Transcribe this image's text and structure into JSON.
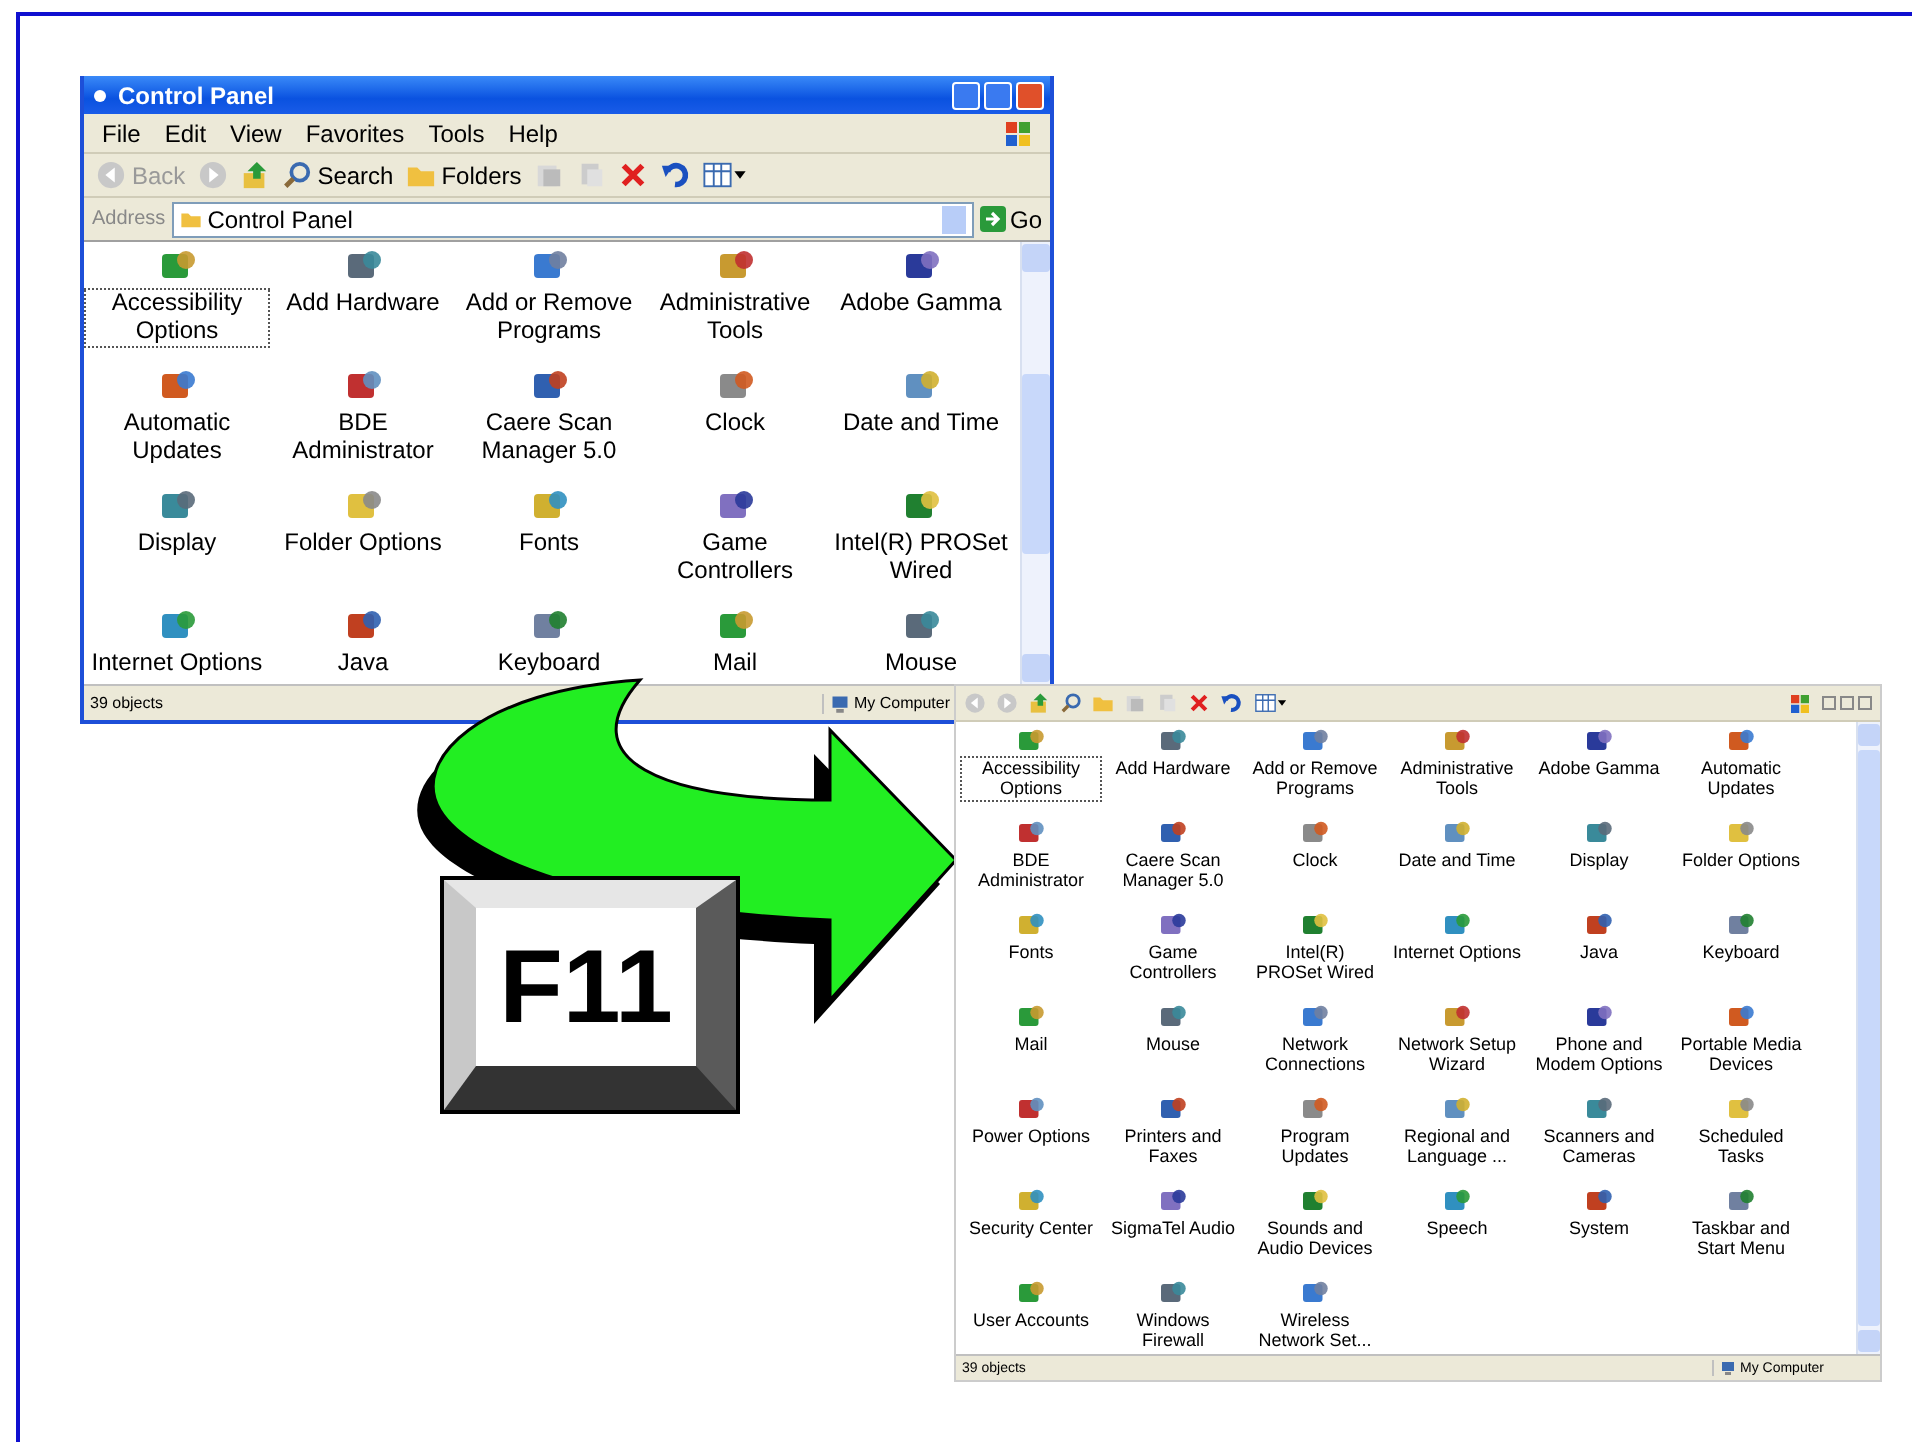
{
  "window": {
    "title": "Control Panel",
    "menu": [
      {
        "label": "File"
      },
      {
        "label": "Edit"
      },
      {
        "label": "View"
      },
      {
        "label": "Favorites"
      },
      {
        "label": "Tools"
      },
      {
        "label": "Help"
      }
    ],
    "toolbar": {
      "back": "Back",
      "search": "Search",
      "folders": "Folders"
    },
    "address": {
      "label": "Address",
      "value": "Control Panel",
      "go": "Go"
    },
    "items": [
      {
        "label": "Accessibility Options",
        "selected": true
      },
      {
        "label": "Add Hardware",
        "selected": false
      },
      {
        "label": "Add or Remove Programs",
        "selected": false
      },
      {
        "label": "Administrative Tools",
        "selected": false
      },
      {
        "label": "Adobe Gamma",
        "selected": false
      },
      {
        "label": "Automatic Updates",
        "selected": false
      },
      {
        "label": "BDE Administrator",
        "selected": false
      },
      {
        "label": "Caere Scan Manager 5.0",
        "selected": false
      },
      {
        "label": "Clock",
        "selected": false
      },
      {
        "label": "Date and Time",
        "selected": false
      },
      {
        "label": "Display",
        "selected": false
      },
      {
        "label": "Folder Options",
        "selected": false
      },
      {
        "label": "Fonts",
        "selected": false
      },
      {
        "label": "Game Controllers",
        "selected": false
      },
      {
        "label": "Intel(R) PROSet Wired",
        "selected": false
      },
      {
        "label": "Internet Options",
        "selected": false
      },
      {
        "label": "Java",
        "selected": false
      },
      {
        "label": "Keyboard",
        "selected": false
      },
      {
        "label": "Mail",
        "selected": false
      },
      {
        "label": "Mouse",
        "selected": false
      }
    ],
    "status_bar": {
      "objects": "39 objects",
      "zone": "My Computer"
    }
  },
  "fullscreen_window": {
    "items": [
      {
        "label": "Accessibility Options",
        "selected": true
      },
      {
        "label": "Add Hardware",
        "selected": false
      },
      {
        "label": "Add or Remove Programs",
        "selected": false
      },
      {
        "label": "Administrative Tools",
        "selected": false
      },
      {
        "label": "Adobe Gamma",
        "selected": false
      },
      {
        "label": "Automatic Updates",
        "selected": false
      },
      {
        "label": "BDE Administrator",
        "selected": false
      },
      {
        "label": "Caere Scan Manager 5.0",
        "selected": false
      },
      {
        "label": "Clock",
        "selected": false
      },
      {
        "label": "Date and Time",
        "selected": false
      },
      {
        "label": "Display",
        "selected": false
      },
      {
        "label": "Folder Options",
        "selected": false
      },
      {
        "label": "Fonts",
        "selected": false
      },
      {
        "label": "Game Controllers",
        "selected": false
      },
      {
        "label": "Intel(R) PROSet Wired",
        "selected": false
      },
      {
        "label": "Internet Options",
        "selected": false
      },
      {
        "label": "Java",
        "selected": false
      },
      {
        "label": "Keyboard",
        "selected": false
      },
      {
        "label": "Mail",
        "selected": false
      },
      {
        "label": "Mouse",
        "selected": false
      },
      {
        "label": "Network Connections",
        "selected": false
      },
      {
        "label": "Network Setup Wizard",
        "selected": false
      },
      {
        "label": "Phone and Modem Options",
        "selected": false
      },
      {
        "label": "Portable Media Devices",
        "selected": false
      },
      {
        "label": "Power Options",
        "selected": false
      },
      {
        "label": "Printers and Faxes",
        "selected": false
      },
      {
        "label": "Program Updates",
        "selected": false
      },
      {
        "label": "Regional and Language ...",
        "selected": false
      },
      {
        "label": "Scanners and Cameras",
        "selected": false
      },
      {
        "label": "Scheduled Tasks",
        "selected": false
      },
      {
        "label": "Security Center",
        "selected": false
      },
      {
        "label": "SigmaTel Audio",
        "selected": false
      },
      {
        "label": "Sounds and Audio Devices",
        "selected": false
      },
      {
        "label": "Speech",
        "selected": false
      },
      {
        "label": "System",
        "selected": false
      },
      {
        "label": "Taskbar and Start Menu",
        "selected": false
      },
      {
        "label": "User Accounts",
        "selected": false
      },
      {
        "label": "Windows Firewall",
        "selected": false
      },
      {
        "label": "Wireless Network Set...",
        "selected": false
      }
    ],
    "status_bar": {
      "objects": "39 objects",
      "zone": "My Computer"
    }
  },
  "key": {
    "label": "F11"
  }
}
